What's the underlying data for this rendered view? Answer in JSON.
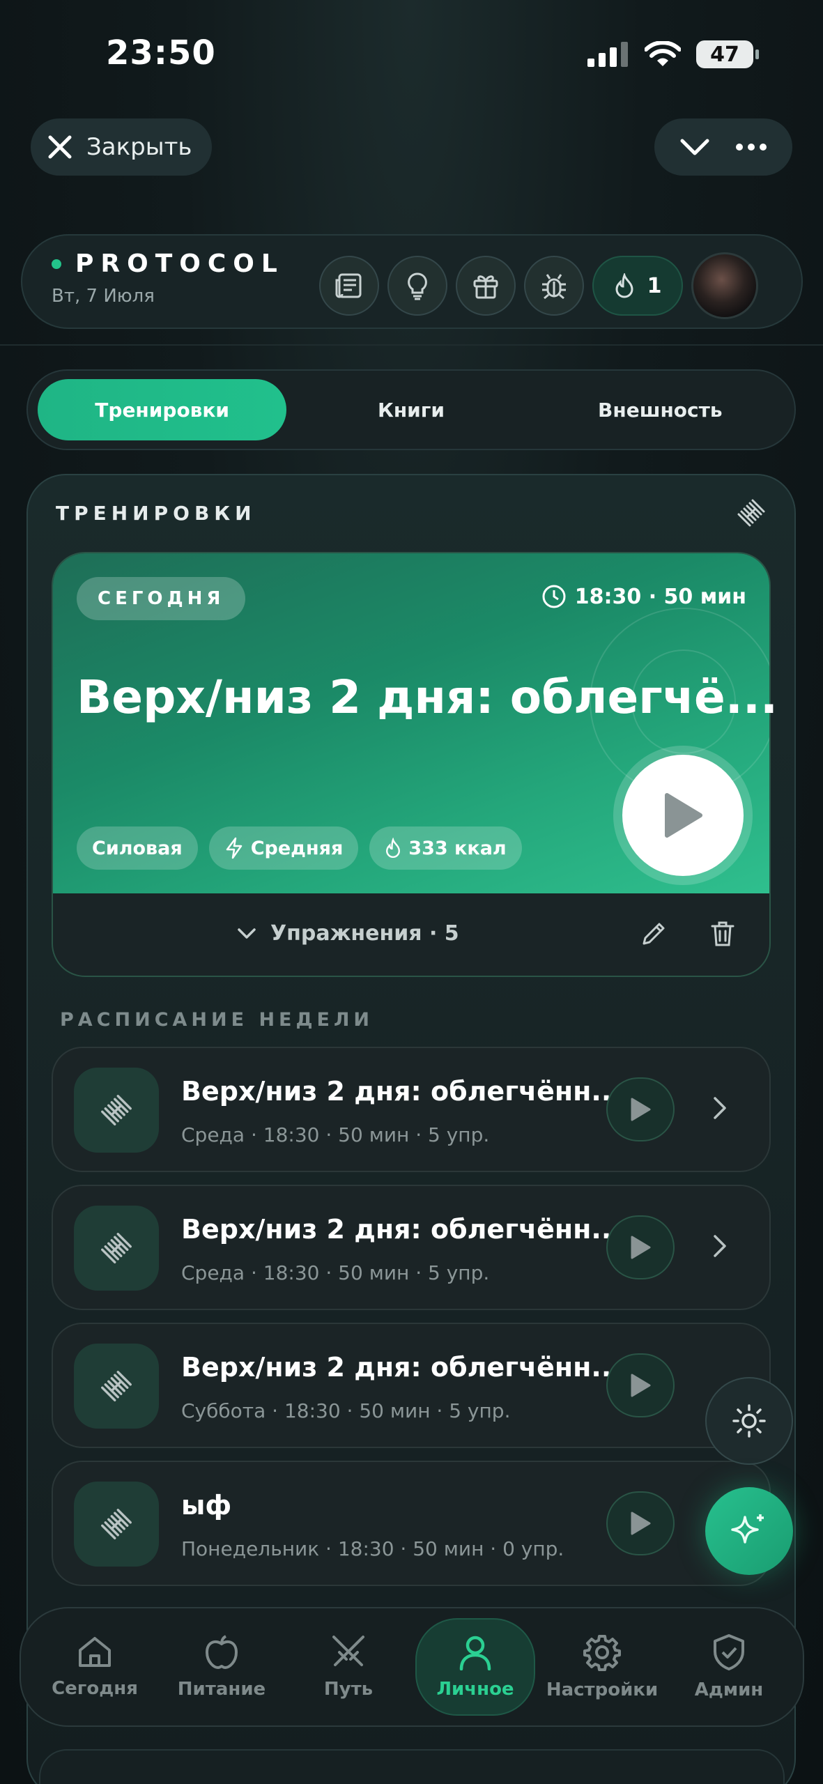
{
  "status": {
    "time": "23:50",
    "battery": "47"
  },
  "top": {
    "close_label": "Закрыть"
  },
  "header": {
    "brand": "PROTOCOL",
    "date": "Вт, 7 Июля",
    "streak": "1"
  },
  "tabs": [
    {
      "label": "Тренировки",
      "active": true
    },
    {
      "label": "Книги",
      "active": false
    },
    {
      "label": "Внешность",
      "active": false
    }
  ],
  "panel": {
    "title": "ТРЕНИРОВКИ"
  },
  "hero": {
    "badge": "СЕГОДНЯ",
    "time": "18:30 · 50 мин",
    "title": "Верх/низ 2 дня: облегчё...",
    "tags": [
      "Силовая",
      "Средняя",
      "333 ккал"
    ],
    "exercises": "Упражнения · 5"
  },
  "schedule": {
    "title": "РАСПИСАНИЕ НЕДЕЛИ",
    "rows": [
      {
        "title": "Верх/низ 2 дня: облегчённ...",
        "sub": "Среда · 18:30 · 50 мин · 5 упр."
      },
      {
        "title": "Верх/низ 2 дня: облегчённ...",
        "sub": "Среда · 18:30 · 50 мин · 5 упр."
      },
      {
        "title": "Верх/низ 2 дня: облегчённ...",
        "sub": "Суббота · 18:30 · 50 мин · 5 упр."
      },
      {
        "title": "ыф",
        "sub": "Понедельник · 18:30 · 50 мин · 0 упр."
      }
    ]
  },
  "nav": [
    {
      "label": "Сегодня",
      "icon": "home-icon"
    },
    {
      "label": "Питание",
      "icon": "apple-icon"
    },
    {
      "label": "Путь",
      "icon": "swords-icon"
    },
    {
      "label": "Личное",
      "icon": "user-icon",
      "active": true
    },
    {
      "label": "Настройки",
      "icon": "gear-icon"
    },
    {
      "label": "Админ",
      "icon": "shield-icon"
    }
  ],
  "colors": {
    "accent": "#23c48a",
    "background": "#0d1416"
  }
}
